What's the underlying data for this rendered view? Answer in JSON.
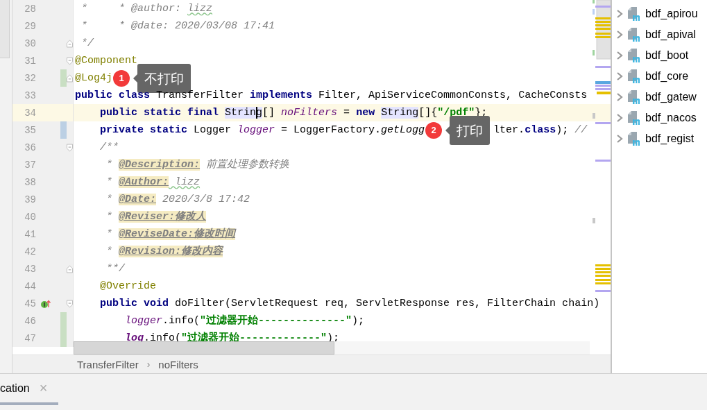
{
  "editor": {
    "lines": [
      {
        "number": "28",
        "current": false,
        "tokens": [
          {
            "kind": "comment",
            "text": " *     * @author: "
          },
          {
            "kind": "comment-typo",
            "text": "lizz"
          }
        ]
      },
      {
        "number": "29",
        "current": false,
        "tokens": [
          {
            "kind": "comment",
            "text": " *     * @date: 2020/03/08 17:41"
          }
        ]
      },
      {
        "number": "30",
        "current": false,
        "fold_end": true,
        "tokens": [
          {
            "kind": "comment",
            "text": " */"
          }
        ]
      },
      {
        "number": "31",
        "current": false,
        "fold_start": true,
        "tokens": [
          {
            "kind": "annotation",
            "text": "@Component"
          }
        ]
      },
      {
        "number": "32",
        "current": false,
        "fold_end": true,
        "added": true,
        "tokens": [
          {
            "kind": "annotation",
            "text": "@Log4j"
          },
          {
            "kind": "callout",
            "number": "1",
            "text": "不打印"
          }
        ]
      },
      {
        "number": "33",
        "current": false,
        "tokens": [
          {
            "kind": "keyword",
            "text": "public class"
          },
          {
            "kind": "plain",
            "text": " TransferFilter "
          },
          {
            "kind": "keyword",
            "text": "implements"
          },
          {
            "kind": "plain",
            "text": " Filter, ApiServiceCommonConsts, CacheConsts"
          }
        ]
      },
      {
        "number": "34",
        "current": true,
        "tokens": [
          {
            "kind": "keyword",
            "text": "    public static final "
          },
          {
            "kind": "plain",
            "text": "Strin",
            "usage_highlight": true
          },
          {
            "kind": "plain",
            "text": "g",
            "usage_highlight": true,
            "caret": true
          },
          {
            "kind": "plain",
            "text": "[] "
          },
          {
            "kind": "field",
            "text": "noFilters"
          },
          {
            "kind": "plain",
            "text": " = "
          },
          {
            "kind": "keyword",
            "text": "new "
          },
          {
            "kind": "plain",
            "text": "String",
            "usage_highlight": true
          },
          {
            "kind": "plain",
            "text": "[]{"
          },
          {
            "kind": "string",
            "text": "\"/pdf\""
          },
          {
            "kind": "plain",
            "text": "};"
          }
        ]
      },
      {
        "number": "35",
        "current": false,
        "modified": true,
        "tokens": [
          {
            "kind": "keyword",
            "text": "    private static"
          },
          {
            "kind": "plain",
            "text": " Logger "
          },
          {
            "kind": "field",
            "text": "logger"
          },
          {
            "kind": "plain",
            "text": " = LoggerFactory."
          },
          {
            "kind": "method",
            "text": "getLogg"
          },
          {
            "kind": "callout",
            "number": "2",
            "text": "打印"
          },
          {
            "kind": "plain",
            "text": "lter."
          },
          {
            "kind": "keyword",
            "text": "class"
          },
          {
            "kind": "plain",
            "text": "); "
          },
          {
            "kind": "comment",
            "text": "//"
          }
        ]
      },
      {
        "number": "36",
        "current": false,
        "fold_start": true,
        "tokens": [
          {
            "kind": "comment",
            "text": "    /**"
          }
        ]
      },
      {
        "number": "37",
        "current": false,
        "tokens": [
          {
            "kind": "comment",
            "text": "     * "
          },
          {
            "kind": "doctag",
            "text": "@Description:"
          },
          {
            "kind": "comment",
            "text": " 前置处理参数转换"
          }
        ]
      },
      {
        "number": "38",
        "current": false,
        "tokens": [
          {
            "kind": "comment",
            "text": "     * "
          },
          {
            "kind": "doctag",
            "text": "@Author:"
          },
          {
            "kind": "comment-typo",
            "text": " lizz"
          }
        ]
      },
      {
        "number": "39",
        "current": false,
        "tokens": [
          {
            "kind": "comment",
            "text": "     * "
          },
          {
            "kind": "doctag",
            "text": "@Date:"
          },
          {
            "kind": "comment",
            "text": " 2020/3/8 17:42"
          }
        ]
      },
      {
        "number": "40",
        "current": false,
        "tokens": [
          {
            "kind": "comment",
            "text": "     * "
          },
          {
            "kind": "doctag",
            "text": "@Reviser:修改人"
          }
        ]
      },
      {
        "number": "41",
        "current": false,
        "tokens": [
          {
            "kind": "comment",
            "text": "     * "
          },
          {
            "kind": "doctag",
            "text": "@ReviseDate:修改时间"
          }
        ]
      },
      {
        "number": "42",
        "current": false,
        "tokens": [
          {
            "kind": "comment",
            "text": "     * "
          },
          {
            "kind": "doctag",
            "text": "@Revision:修改内容"
          }
        ]
      },
      {
        "number": "43",
        "current": false,
        "fold_end": true,
        "tokens": [
          {
            "kind": "comment",
            "text": "     **/"
          }
        ]
      },
      {
        "number": "44",
        "current": false,
        "tokens": [
          {
            "kind": "annotation",
            "text": "    @Override"
          }
        ]
      },
      {
        "number": "45",
        "current": false,
        "fold_start": true,
        "implements_marker": true,
        "tokens": [
          {
            "kind": "keyword",
            "text": "    public void"
          },
          {
            "kind": "plain",
            "text": " doFilter(ServletRequest req, ServletResponse res, FilterChain chain)"
          }
        ]
      },
      {
        "number": "46",
        "current": false,
        "added": true,
        "tokens": [
          {
            "kind": "field",
            "text": "        logger"
          },
          {
            "kind": "plain",
            "text": ".info("
          },
          {
            "kind": "string",
            "text": "\"过滤器开始--------------\""
          },
          {
            "kind": "plain",
            "text": ");"
          }
        ]
      },
      {
        "number": "47",
        "current": false,
        "added": true,
        "tokens": [
          {
            "kind": "field-bold",
            "text": "        log"
          },
          {
            "kind": "plain",
            "text": ".info("
          },
          {
            "kind": "string",
            "text": "\"过滤器开始-------------\""
          },
          {
            "kind": "plain",
            "text": ");"
          }
        ]
      }
    ]
  },
  "breadcrumb": [
    "TransferFilter",
    "noFilters"
  ],
  "breadcrumb_separator": "›",
  "project_tree": {
    "items": [
      {
        "label": "bdf_apirou",
        "expanded": false
      },
      {
        "label": "bdf_apival",
        "expanded": false
      },
      {
        "label": "bdf_boot",
        "expanded": false
      },
      {
        "label": "bdf_core",
        "expanded": false
      },
      {
        "label": "bdf_gatew",
        "expanded": false
      },
      {
        "label": "bdf_nacos",
        "expanded": false
      },
      {
        "label": "bdf_regist",
        "expanded": false
      }
    ]
  },
  "bottom_tabs": [
    {
      "label": "cation",
      "selected": true,
      "close": "×"
    }
  ]
}
